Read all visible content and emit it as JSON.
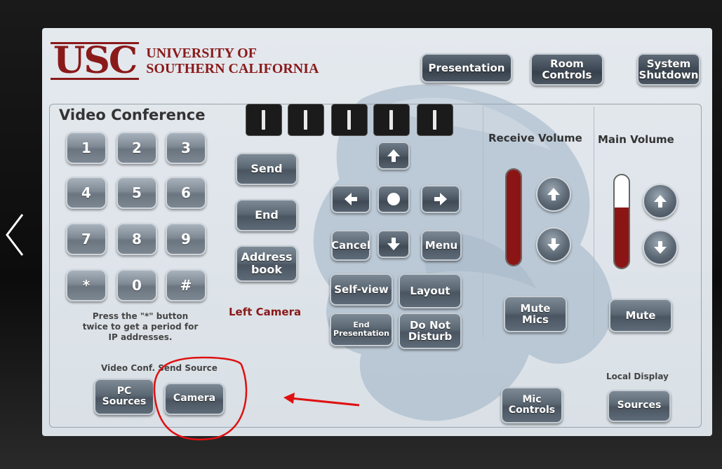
{
  "header": {
    "logo_short": "USC",
    "logo_line1": "UNIVERSITY OF",
    "logo_line2": "SOUTHERN CALIFORNIA",
    "btn_presentation": "Presentation",
    "btn_room_controls_1": "Room",
    "btn_room_controls_2": "Controls",
    "btn_shutdown_1": "System",
    "btn_shutdown_2": "Shutdown"
  },
  "video_conference": {
    "title": "Video Conference",
    "keys": [
      "1",
      "2",
      "3",
      "4",
      "5",
      "6",
      "7",
      "8",
      "9",
      "*",
      "0",
      "#"
    ],
    "hint_lines": [
      "Press the \"*\" button",
      "twice to get a period for",
      "IP addresses."
    ],
    "send": "Send",
    "end": "End",
    "address_1": "Address",
    "address_2": "book",
    "left_camera": "Left Camera"
  },
  "camera_nav": {
    "cancel": "Cancel",
    "menu": "Menu",
    "self_view": "Self-view",
    "layout": "Layout",
    "end_presentation_1": "End",
    "end_presentation_2": "Presentation",
    "do_not_disturb_1": "Do Not",
    "do_not_disturb_2": "Disturb"
  },
  "receive_volume": {
    "title": "Receive Volume",
    "level": 1.0,
    "mute_mics_1": "Mute",
    "mute_mics_2": "Mics"
  },
  "main_volume": {
    "title": "Main Volume",
    "level": 0.65,
    "mute": "Mute"
  },
  "send_source": {
    "label": "Video Conf. Send Source",
    "pc_1": "PC",
    "pc_2": "Sources",
    "camera": "Camera"
  },
  "bottom": {
    "mic_1": "Mic",
    "mic_2": "Controls",
    "local_display": "Local Display",
    "sources": "Sources"
  },
  "colors": {
    "brand": "#8a1a1a",
    "annotation": "#e01010"
  }
}
